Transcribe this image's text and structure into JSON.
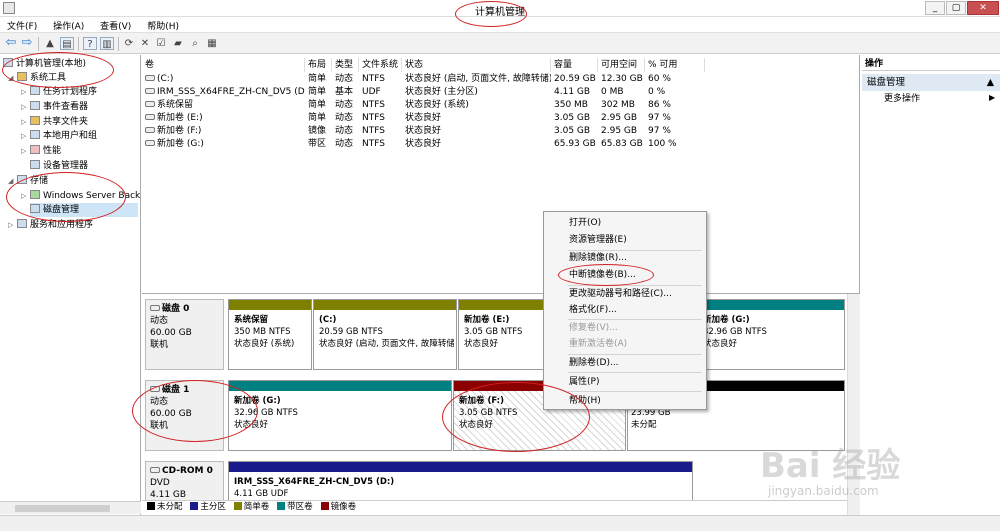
{
  "window": {
    "title": "计算机管理",
    "min": "_",
    "max": "▢",
    "close": "✕"
  },
  "menu": [
    "文件(F)",
    "操作(A)",
    "查看(V)",
    "帮助(H)"
  ],
  "tree": {
    "root": "计算机管理(本地)",
    "system_tools": "系统工具",
    "task_scheduler": "任务计划程序",
    "event_viewer": "事件查看器",
    "shared_folders": "共享文件夹",
    "local_users": "本地用户和组",
    "performance": "性能",
    "device_manager": "设备管理器",
    "storage": "存储",
    "windows_backup": "Windows Server Back",
    "disk_management": "磁盘管理",
    "services_apps": "服务和应用程序"
  },
  "volume_list": {
    "headers": [
      "卷",
      "布局",
      "类型",
      "文件系统",
      "状态",
      "容量",
      "可用空间",
      "% 可用"
    ],
    "rows": [
      [
        "(C:)",
        "简单",
        "动态",
        "NTFS",
        "状态良好 (启动, 页面文件, 故障转储)",
        "20.59 GB",
        "12.30 GB",
        "60 %"
      ],
      [
        "IRM_SSS_X64FRE_ZH-CN_DV5 (D:)",
        "简单",
        "基本",
        "UDF",
        "状态良好 (主分区)",
        "4.11 GB",
        "0 MB",
        "0 %"
      ],
      [
        "系统保留",
        "简单",
        "动态",
        "NTFS",
        "状态良好 (系统)",
        "350 MB",
        "302 MB",
        "86 %"
      ],
      [
        "新加卷 (E:)",
        "简单",
        "动态",
        "NTFS",
        "状态良好",
        "3.05 GB",
        "2.95 GB",
        "97 %"
      ],
      [
        "新加卷 (F:)",
        "镜像",
        "动态",
        "NTFS",
        "状态良好",
        "3.05 GB",
        "2.95 GB",
        "97 %"
      ],
      [
        "新加卷 (G:)",
        "带区",
        "动态",
        "NTFS",
        "状态良好",
        "65.93 GB",
        "65.83 GB",
        "100 %"
      ]
    ]
  },
  "disks": {
    "disk0": {
      "name": "磁盘 0",
      "type": "动态",
      "size": "60.00 GB",
      "status": "联机",
      "p1": {
        "name": "系统保留",
        "size": "350 MB NTFS",
        "status": "状态良好 (系统)"
      },
      "p2": {
        "name": "(C:)",
        "size": "20.59 GB NTFS",
        "status": "状态良好 (启动, 页面文件, 故障转储)"
      },
      "p3": {
        "name": "新加卷 (E:)",
        "size": "3.05 GB NTFS",
        "status": "状态良好"
      },
      "p4": {
        "name": "新加卷 (G:)",
        "size": "32.96 GB NTFS",
        "status": "状态良好"
      }
    },
    "disk1": {
      "name": "磁盘 1",
      "type": "动态",
      "size": "60.00 GB",
      "status": "联机",
      "p1": {
        "name": "新加卷 (G:)",
        "size": "32.96 GB NTFS",
        "status": "状态良好"
      },
      "p2": {
        "name": "新加卷 (F:)",
        "size": "3.05 GB NTFS",
        "status": "状态良好"
      },
      "p3": {
        "size": "23.99 GB",
        "status": "未分配"
      }
    },
    "cdrom0": {
      "name": "CD-ROM 0",
      "type": "DVD",
      "size": "4.11 GB",
      "p1": {
        "name": "IRM_SSS_X64FRE_ZH-CN_DV5 (D:)",
        "size": "4.11 GB UDF"
      }
    }
  },
  "legend": [
    {
      "label": "未分配",
      "color": "#000000"
    },
    {
      "label": "主分区",
      "color": "#1a1a8c"
    },
    {
      "label": "简单卷",
      "color": "#808000"
    },
    {
      "label": "带区卷",
      "color": "#008080"
    },
    {
      "label": "镜像卷",
      "color": "#8b0000"
    }
  ],
  "actions": {
    "header": "操作",
    "section": "磁盘管理",
    "more": "更多操作"
  },
  "context_menu": {
    "open": "打开(O)",
    "explorer": "资源管理器(E)",
    "remove_mirror": "删除镜像(R)...",
    "break_mirror": "中断镜像卷(B)...",
    "change_letter": "更改驱动器号和路径(C)...",
    "format": "格式化(F)...",
    "repair": "修复卷(V)...",
    "reactivate": "重新激活卷(A)",
    "delete": "删除卷(D)...",
    "properties": "属性(P)",
    "help": "帮助(H)"
  },
  "watermark": {
    "brand": "Bai 经验",
    "url": "jingyan.baidu.com"
  }
}
